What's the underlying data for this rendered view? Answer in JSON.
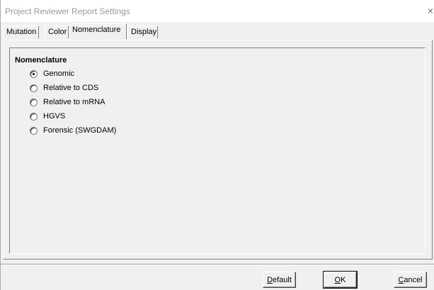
{
  "window": {
    "title": "Project Reviewer Report Settings",
    "close_glyph": "×"
  },
  "tabs": [
    {
      "label": "Mutation",
      "active": false
    },
    {
      "label": "Color",
      "active": false
    },
    {
      "label": "Nomenclature",
      "active": true
    },
    {
      "label": "Display",
      "active": false
    }
  ],
  "group": {
    "title": "Nomenclature",
    "options": [
      {
        "label": "Genomic",
        "checked": true
      },
      {
        "label": "Relative to CDS",
        "checked": false
      },
      {
        "label": "Relative to mRNA",
        "checked": false
      },
      {
        "label": "HGVS",
        "checked": false
      },
      {
        "label": "Forensic (SWGDAM)",
        "checked": false
      }
    ]
  },
  "buttons": {
    "default": {
      "mnemonic": "D",
      "rest": "efault"
    },
    "ok": {
      "mnemonic": "O",
      "rest": "K"
    },
    "cancel": {
      "mnemonic": "C",
      "rest": "ancel"
    }
  }
}
